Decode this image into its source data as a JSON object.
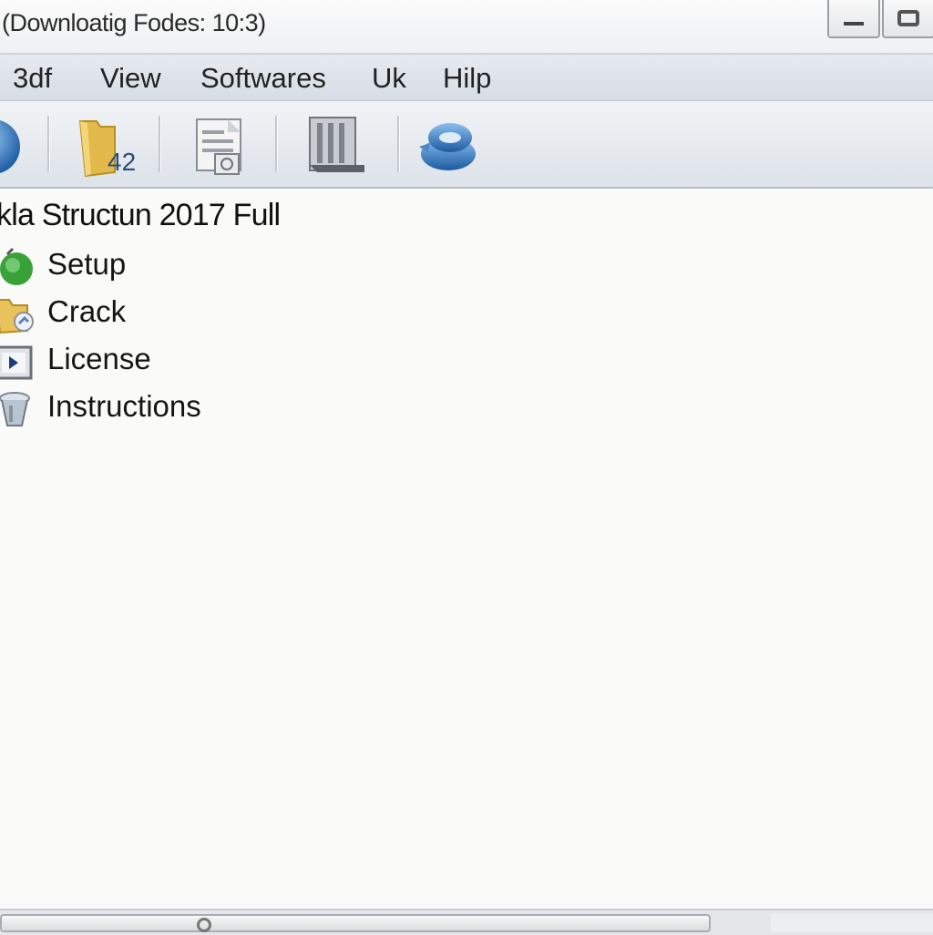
{
  "window": {
    "title": "(Downloatig Fodes: 10:3)",
    "controls": [
      "minimize-icon",
      "restore-icon"
    ]
  },
  "menu": {
    "items": [
      {
        "label": "3df"
      },
      {
        "label": "View"
      },
      {
        "label": "Softwares"
      },
      {
        "label": "Uk"
      },
      {
        "label": "Hilp"
      }
    ]
  },
  "toolbar": {
    "icons": [
      "globe-icon",
      "folder-icon",
      "document-icon",
      "building-icon",
      "network-icon"
    ],
    "folder_badge": "42"
  },
  "content": {
    "folder_title": "kla Structun 2017 Full",
    "files": [
      {
        "name": "Setup",
        "icon": "setup-icon"
      },
      {
        "name": "Crack",
        "icon": "folder-shortcut-icon"
      },
      {
        "name": "License",
        "icon": "license-icon"
      },
      {
        "name": "Instructions",
        "icon": "instructions-icon"
      }
    ]
  },
  "colors": {
    "menubar_bg": "#dde2ea",
    "toolbar_bg": "#e6e9ee",
    "content_bg": "#fafaf8",
    "accent_blue": "#2f6fb8",
    "folder_yellow": "#e9c45a",
    "setup_green": "#3aa43a"
  }
}
